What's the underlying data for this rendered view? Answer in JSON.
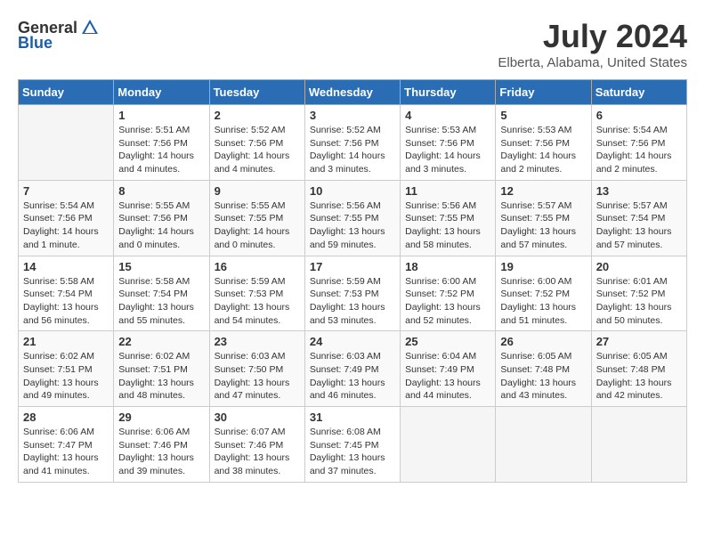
{
  "logo": {
    "general": "General",
    "blue": "Blue"
  },
  "title": "July 2024",
  "location": "Elberta, Alabama, United States",
  "headers": [
    "Sunday",
    "Monday",
    "Tuesday",
    "Wednesday",
    "Thursday",
    "Friday",
    "Saturday"
  ],
  "weeks": [
    [
      {
        "day": "",
        "info": "",
        "empty": true
      },
      {
        "day": "1",
        "info": "Sunrise: 5:51 AM\nSunset: 7:56 PM\nDaylight: 14 hours\nand 4 minutes."
      },
      {
        "day": "2",
        "info": "Sunrise: 5:52 AM\nSunset: 7:56 PM\nDaylight: 14 hours\nand 4 minutes."
      },
      {
        "day": "3",
        "info": "Sunrise: 5:52 AM\nSunset: 7:56 PM\nDaylight: 14 hours\nand 3 minutes."
      },
      {
        "day": "4",
        "info": "Sunrise: 5:53 AM\nSunset: 7:56 PM\nDaylight: 14 hours\nand 3 minutes."
      },
      {
        "day": "5",
        "info": "Sunrise: 5:53 AM\nSunset: 7:56 PM\nDaylight: 14 hours\nand 2 minutes."
      },
      {
        "day": "6",
        "info": "Sunrise: 5:54 AM\nSunset: 7:56 PM\nDaylight: 14 hours\nand 2 minutes."
      }
    ],
    [
      {
        "day": "7",
        "info": "Sunrise: 5:54 AM\nSunset: 7:56 PM\nDaylight: 14 hours\nand 1 minute."
      },
      {
        "day": "8",
        "info": "Sunrise: 5:55 AM\nSunset: 7:56 PM\nDaylight: 14 hours\nand 0 minutes."
      },
      {
        "day": "9",
        "info": "Sunrise: 5:55 AM\nSunset: 7:55 PM\nDaylight: 14 hours\nand 0 minutes."
      },
      {
        "day": "10",
        "info": "Sunrise: 5:56 AM\nSunset: 7:55 PM\nDaylight: 13 hours\nand 59 minutes."
      },
      {
        "day": "11",
        "info": "Sunrise: 5:56 AM\nSunset: 7:55 PM\nDaylight: 13 hours\nand 58 minutes."
      },
      {
        "day": "12",
        "info": "Sunrise: 5:57 AM\nSunset: 7:55 PM\nDaylight: 13 hours\nand 57 minutes."
      },
      {
        "day": "13",
        "info": "Sunrise: 5:57 AM\nSunset: 7:54 PM\nDaylight: 13 hours\nand 57 minutes."
      }
    ],
    [
      {
        "day": "14",
        "info": "Sunrise: 5:58 AM\nSunset: 7:54 PM\nDaylight: 13 hours\nand 56 minutes."
      },
      {
        "day": "15",
        "info": "Sunrise: 5:58 AM\nSunset: 7:54 PM\nDaylight: 13 hours\nand 55 minutes."
      },
      {
        "day": "16",
        "info": "Sunrise: 5:59 AM\nSunset: 7:53 PM\nDaylight: 13 hours\nand 54 minutes."
      },
      {
        "day": "17",
        "info": "Sunrise: 5:59 AM\nSunset: 7:53 PM\nDaylight: 13 hours\nand 53 minutes."
      },
      {
        "day": "18",
        "info": "Sunrise: 6:00 AM\nSunset: 7:52 PM\nDaylight: 13 hours\nand 52 minutes."
      },
      {
        "day": "19",
        "info": "Sunrise: 6:00 AM\nSunset: 7:52 PM\nDaylight: 13 hours\nand 51 minutes."
      },
      {
        "day": "20",
        "info": "Sunrise: 6:01 AM\nSunset: 7:52 PM\nDaylight: 13 hours\nand 50 minutes."
      }
    ],
    [
      {
        "day": "21",
        "info": "Sunrise: 6:02 AM\nSunset: 7:51 PM\nDaylight: 13 hours\nand 49 minutes."
      },
      {
        "day": "22",
        "info": "Sunrise: 6:02 AM\nSunset: 7:51 PM\nDaylight: 13 hours\nand 48 minutes."
      },
      {
        "day": "23",
        "info": "Sunrise: 6:03 AM\nSunset: 7:50 PM\nDaylight: 13 hours\nand 47 minutes."
      },
      {
        "day": "24",
        "info": "Sunrise: 6:03 AM\nSunset: 7:49 PM\nDaylight: 13 hours\nand 46 minutes."
      },
      {
        "day": "25",
        "info": "Sunrise: 6:04 AM\nSunset: 7:49 PM\nDaylight: 13 hours\nand 44 minutes."
      },
      {
        "day": "26",
        "info": "Sunrise: 6:05 AM\nSunset: 7:48 PM\nDaylight: 13 hours\nand 43 minutes."
      },
      {
        "day": "27",
        "info": "Sunrise: 6:05 AM\nSunset: 7:48 PM\nDaylight: 13 hours\nand 42 minutes."
      }
    ],
    [
      {
        "day": "28",
        "info": "Sunrise: 6:06 AM\nSunset: 7:47 PM\nDaylight: 13 hours\nand 41 minutes."
      },
      {
        "day": "29",
        "info": "Sunrise: 6:06 AM\nSunset: 7:46 PM\nDaylight: 13 hours\nand 39 minutes."
      },
      {
        "day": "30",
        "info": "Sunrise: 6:07 AM\nSunset: 7:46 PM\nDaylight: 13 hours\nand 38 minutes."
      },
      {
        "day": "31",
        "info": "Sunrise: 6:08 AM\nSunset: 7:45 PM\nDaylight: 13 hours\nand 37 minutes."
      },
      {
        "day": "",
        "info": "",
        "empty": true
      },
      {
        "day": "",
        "info": "",
        "empty": true
      },
      {
        "day": "",
        "info": "",
        "empty": true
      }
    ]
  ]
}
